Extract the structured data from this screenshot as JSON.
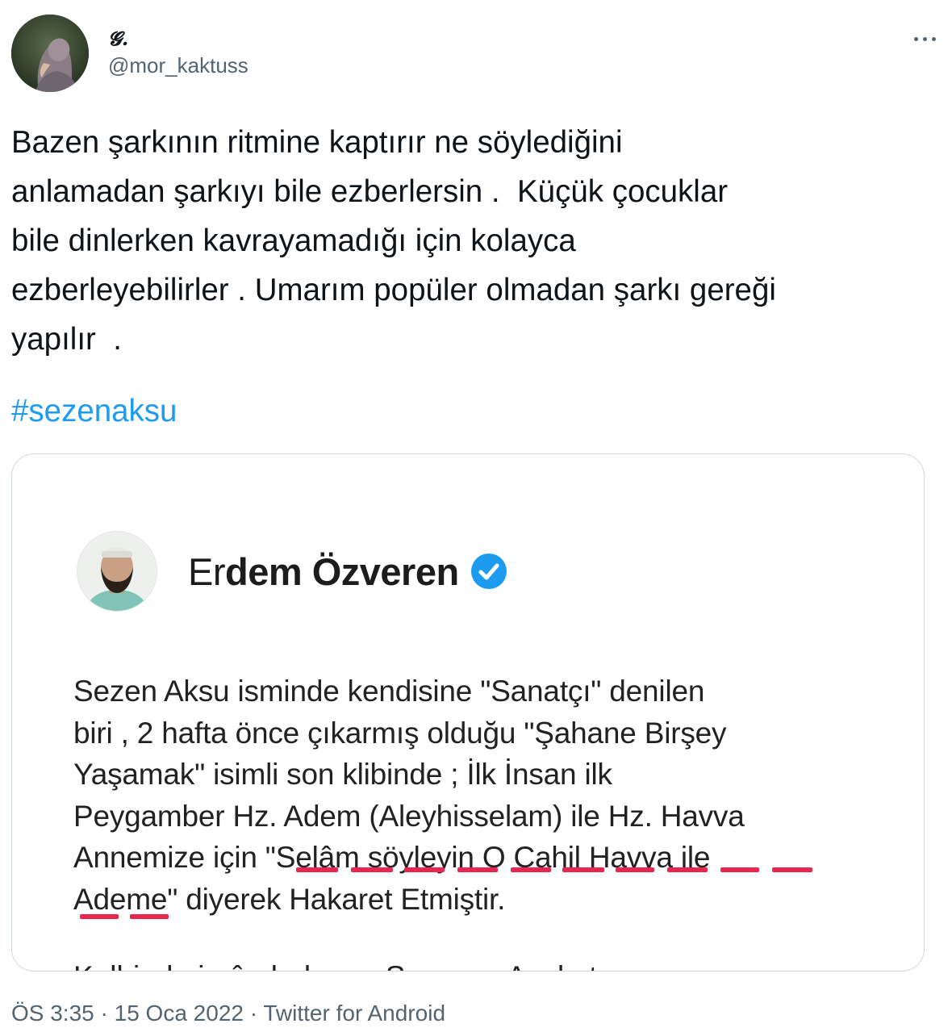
{
  "tweet": {
    "author": {
      "display_name": "𝓖.",
      "handle": "@mor_kaktuss",
      "avatar_icon": "profile-photo"
    },
    "more_icon": "more-horizontal-icon",
    "text": "Bazen şarkının ritmine kaptırır ne söylediğini\nanlamadan şarkıyı bile ezberlersin .  Küçük çocuklar\nbile dinlerken kavrayamadığı için kolayca\nezberleyebilirler . Umarım popüler olmadan şarkı gereği\nyapılır  .",
    "hashtag": "#sezenaksu",
    "hashtag_color": "#1d9bf0",
    "timestamp_time": "ÖS 3:35",
    "timestamp_date": "15 Oca 2022",
    "source": "Twitter for Android",
    "separator": "·"
  },
  "embedded_image": {
    "name_light": "Er",
    "name_bold": "dem Özveren",
    "verified_icon": "verified-badge-icon",
    "verified_color": "#1d9bf0",
    "underline_color": "#e8264f",
    "body": "Sezen Aksu isminde kendisine \"Sanatçı\" denilen\nbiri , 2 hafta önce çıkarmış olduğu \"Şahane Birşey\nYaşamak\" isimli son klibinde ; İlk İnsan ilk\nPeygamber Hz. Adem (Aleyhisselam) ile Hz. Havva\nAnnemize için \"Selâm söyleyin O Cahil Havva ile\nAdeme\" diyerek Hakaret Etmiştir.",
    "cut_off_line": "Kalbinde imân bulunan Savcı ve Avukat"
  }
}
